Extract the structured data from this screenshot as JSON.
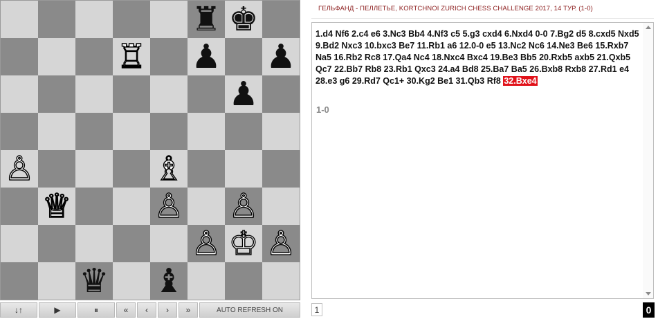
{
  "game": {
    "title": "ГЕЛЬФАНД - ПЕЛЛЕТЬЕ, KORTCHNOI ZURICH CHESS CHALLENGE 2017, 14 ТУР. (1-0)",
    "moves_text": "1.d4 Nf6 2.c4 e6 3.Nc3 Bb4 4.Nf3 c5 5.g3 cxd4 6.Nxd4 0-0 7.Bg2 d5 8.cxd5 Nxd5 9.Bd2 Nxc3 10.bxc3 Be7 11.Rb1 a6 12.0-0 e5 13.Nc2 Nc6 14.Ne3 Be6 15.Rxb7 Na5 16.Rb2 Rc8 17.Qa4 Nc4 18.Nxc4 Bxc4 19.Be3 Bb5 20.Rxb5 axb5 21.Qxb5 Qc7 22.Bb7 Rb8 23.Rb1 Qxc3 24.a4 Bd8 25.Ba7 Ba5 26.Bxb8 Rxb8 27.Rd1 e4 28.e3 g6 29.Rd7 Qc1+ 30.Kg2 Be1 31.Qb3 Rf8",
    "current_move": "32.Bxe4",
    "result": "1-0",
    "page": "1",
    "counter": "0"
  },
  "controls": [
    {
      "name": "flip-board-button",
      "label": "↓↑"
    },
    {
      "name": "play-button",
      "label": "▶"
    },
    {
      "name": "pause-button",
      "label": "⏸"
    },
    {
      "name": "first-move-button",
      "label": "«"
    },
    {
      "name": "prev-move-button",
      "label": "‹"
    },
    {
      "name": "next-move-button",
      "label": "›"
    },
    {
      "name": "last-move-button",
      "label": "»"
    }
  ],
  "auto_refresh_label": "AUTO REFRESH ON",
  "board": {
    "orientation": "white-bottom",
    "pieces": [
      {
        "square": "f8",
        "color": "black",
        "type": "rook"
      },
      {
        "square": "g8",
        "color": "black",
        "type": "king"
      },
      {
        "square": "d7",
        "color": "white",
        "type": "rook"
      },
      {
        "square": "f7",
        "color": "black",
        "type": "pawn"
      },
      {
        "square": "h7",
        "color": "black",
        "type": "pawn"
      },
      {
        "square": "g6",
        "color": "black",
        "type": "pawn"
      },
      {
        "square": "a4",
        "color": "white",
        "type": "pawn"
      },
      {
        "square": "e4",
        "color": "white",
        "type": "bishop"
      },
      {
        "square": "b3",
        "color": "white",
        "type": "queen"
      },
      {
        "square": "e3",
        "color": "white",
        "type": "pawn"
      },
      {
        "square": "g3",
        "color": "white",
        "type": "pawn"
      },
      {
        "square": "f2",
        "color": "white",
        "type": "pawn"
      },
      {
        "square": "g2",
        "color": "white",
        "type": "king"
      },
      {
        "square": "h2",
        "color": "white",
        "type": "pawn"
      },
      {
        "square": "c1",
        "color": "black",
        "type": "queen"
      },
      {
        "square": "e1",
        "color": "black",
        "type": "bishop"
      }
    ]
  },
  "colors": {
    "light_square": "#d6d6d6",
    "dark_square": "#8a8a8a",
    "highlight": "#e1121a",
    "title": "#8b1b1b"
  }
}
